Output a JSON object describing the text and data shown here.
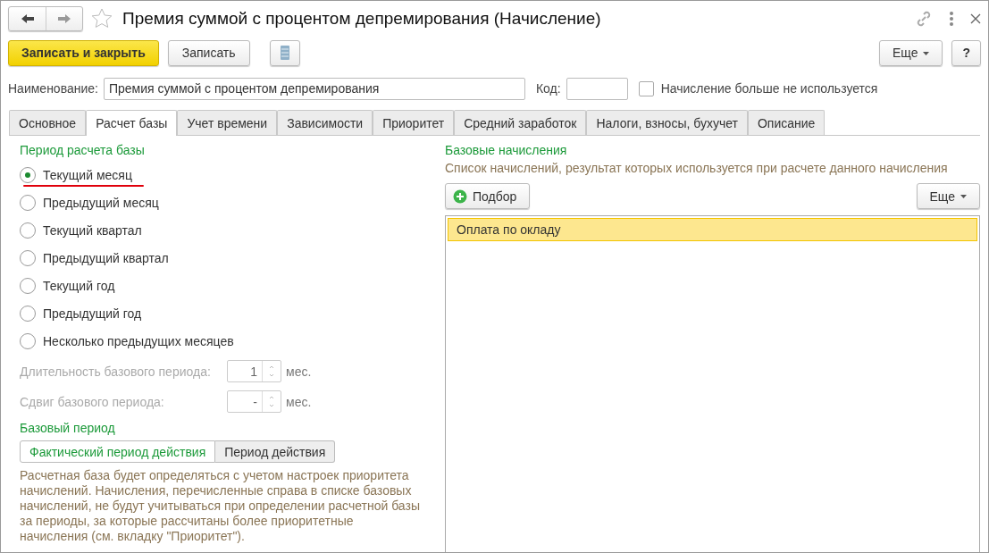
{
  "window": {
    "title": "Премия суммой с процентом депремирования (Начисление)"
  },
  "toolbar": {
    "primary": "Записать и закрыть",
    "save": "Записать",
    "more": "Еще",
    "help": "?"
  },
  "name_row": {
    "label": "Наименование:",
    "value": "Премия суммой с процентом депремирования",
    "code_label": "Код:",
    "unused_label": "Начисление больше не используется",
    "unused_checked": false
  },
  "tabs": [
    {
      "label": "Основное",
      "selected": false
    },
    {
      "label": "Расчет базы",
      "selected": true
    },
    {
      "label": "Учет времени",
      "selected": false
    },
    {
      "label": "Зависимости",
      "selected": false
    },
    {
      "label": "Приоритет",
      "selected": false
    },
    {
      "label": "Средний заработок",
      "selected": false
    },
    {
      "label": "Налоги, взносы, бухучет",
      "selected": false
    },
    {
      "label": "Описание",
      "selected": false
    }
  ],
  "period": {
    "title": "Период расчета базы",
    "options": [
      {
        "label": "Текущий месяц",
        "selected": true,
        "underlined": true
      },
      {
        "label": "Предыдущий месяц",
        "selected": false,
        "underlined": false
      },
      {
        "label": "Текущий квартал",
        "selected": false,
        "underlined": false
      },
      {
        "label": "Предыдущий квартал",
        "selected": false,
        "underlined": false
      },
      {
        "label": "Текущий год",
        "selected": false,
        "underlined": false
      },
      {
        "label": "Предыдущий год",
        "selected": false,
        "underlined": false
      },
      {
        "label": "Несколько предыдущих месяцев",
        "selected": false,
        "underlined": false
      }
    ],
    "fields": [
      {
        "label": "Длительность базового периода:",
        "value": "1",
        "unit": "мес.",
        "disabled": true
      },
      {
        "label": "Сдвиг базового периода:",
        "value": "-",
        "unit": "мес.",
        "disabled": true
      }
    ]
  },
  "base_period": {
    "title": "Базовый период",
    "options": [
      {
        "label": "Фактический период действия",
        "selected": true
      },
      {
        "label": "Период действия",
        "selected": false
      }
    ],
    "note": "Расчетная база будет определяться с учетом настроек приоритета начислений. Начисления, перечисленные справа в списке базовых начислений, не будут учитываться при определении расчетной базы за периоды, за которые рассчитаны более приоритетные начисления (см. вкладку \"Приоритет\")."
  },
  "base_accruals": {
    "title": "Базовые начисления",
    "subtitle": "Список начислений, результат которых используется при расчете данного начисления",
    "pick": "Подбор",
    "more": "Еще",
    "rows": [
      {
        "label": "Оплата по окладу",
        "selected": true
      }
    ]
  }
}
